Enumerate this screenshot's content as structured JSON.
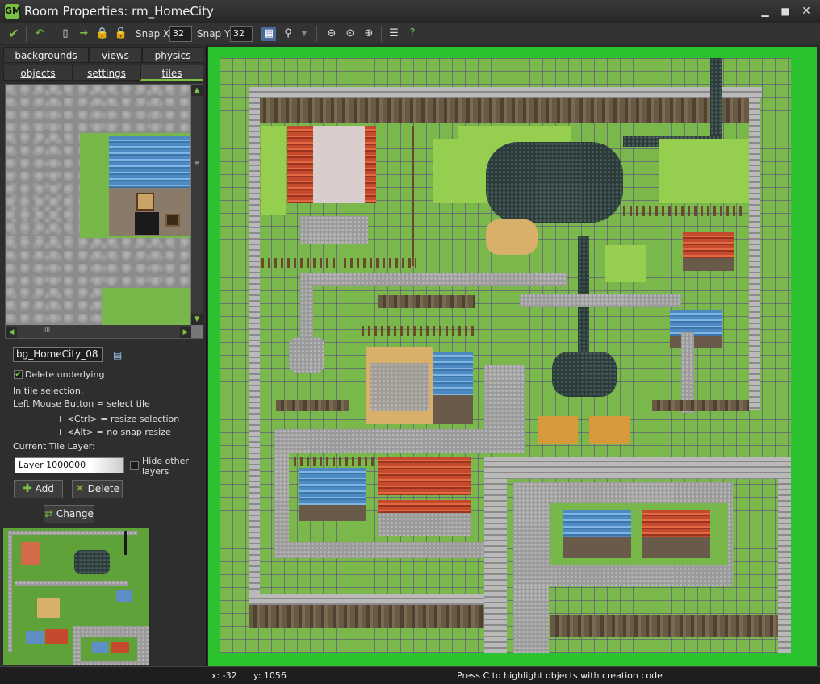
{
  "window": {
    "title": "Room Properties: rm_HomeCity",
    "app_icon_text": "GM"
  },
  "toolbar": {
    "snap_x_label": "Snap X:",
    "snap_x_value": "32",
    "snap_y_label": "Snap Y:",
    "snap_y_value": "32"
  },
  "tabs": {
    "row1": [
      "backgrounds",
      "views",
      "physics"
    ],
    "row2": [
      "objects",
      "settings",
      "tiles"
    ],
    "active": "tiles"
  },
  "tiles_panel": {
    "background_name": "bg_HomeCity_08",
    "delete_underlying_label": "Delete underlying",
    "delete_underlying_checked": true,
    "help_line1": "In tile selection:",
    "help_line2": "Left Mouse Button  = select tile",
    "help_line3": "+ <Ctrl> = resize selection",
    "help_line4": "+ <Alt> =  no snap resize",
    "current_layer_label": "Current Tile Layer:",
    "layer_value": "Layer 1000000",
    "hide_other_label": "Hide other layers",
    "add_label": "Add",
    "delete_label": "Delete",
    "change_label": "Change"
  },
  "status": {
    "x_label": "x: -32",
    "y_label": "y: 1056",
    "message": "Press C to highlight objects with creation code"
  },
  "colors": {
    "accent": "#7ac142",
    "canvas_border": "#2cc12e",
    "grid": "#5a3c8c"
  }
}
